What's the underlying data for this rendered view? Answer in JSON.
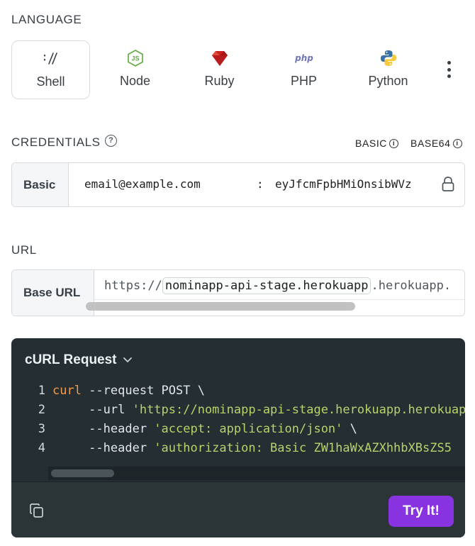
{
  "language_section": {
    "label": "LANGUAGE",
    "languages": [
      {
        "name": "Shell",
        "icon": "shell-icon",
        "active": true
      },
      {
        "name": "Node",
        "icon": "nodejs-icon",
        "active": false
      },
      {
        "name": "Ruby",
        "icon": "ruby-icon",
        "active": false
      },
      {
        "name": "PHP",
        "icon": "php-icon",
        "active": false
      },
      {
        "name": "Python",
        "icon": "python-icon",
        "active": false
      }
    ],
    "more_icon": "more-vertical-icon"
  },
  "credentials": {
    "label": "CREDENTIALS",
    "help_icon": "help-icon",
    "auth_options": [
      {
        "label": "BASIC",
        "icon": "info-icon"
      },
      {
        "label": "BASE64",
        "icon": "info-icon"
      }
    ],
    "tag": "Basic",
    "username": "email@example.com",
    "separator": ":",
    "password": "eyJfcmFpbHMiOnsibWVz",
    "lock_icon": "lock-icon"
  },
  "url_section": {
    "label": "URL",
    "tag": "Base URL",
    "prefix": "https://",
    "host_value": "nominapp-api-stage.herokuapp",
    "suffix": ".herokuapp."
  },
  "code_panel": {
    "title": "cURL Request",
    "chevron_icon": "chevron-down-icon",
    "lines": [
      {
        "num": "1",
        "parts": [
          {
            "t": "curl",
            "c": "kw"
          },
          {
            "t": " --request POST \\",
            "c": ""
          }
        ]
      },
      {
        "num": "2",
        "parts": [
          {
            "t": "     --url ",
            "c": ""
          },
          {
            "t": "'https://nominapp-api-stage.herokuapp.herokuap",
            "c": "str"
          }
        ]
      },
      {
        "num": "3",
        "parts": [
          {
            "t": "     --header ",
            "c": ""
          },
          {
            "t": "'accept: application/json'",
            "c": "str"
          },
          {
            "t": " \\",
            "c": ""
          }
        ]
      },
      {
        "num": "4",
        "parts": [
          {
            "t": "     --header ",
            "c": ""
          },
          {
            "t": "'authorization: Basic ZW1haWxAZXhhbXBsZS5",
            "c": "str"
          }
        ]
      }
    ],
    "copy_icon": "copy-icon",
    "try_label": "Try It!"
  },
  "colors": {
    "accent": "#8734e0",
    "code_bg": "#242e33",
    "keyword": "#f29d49",
    "string": "#b7d46b"
  }
}
